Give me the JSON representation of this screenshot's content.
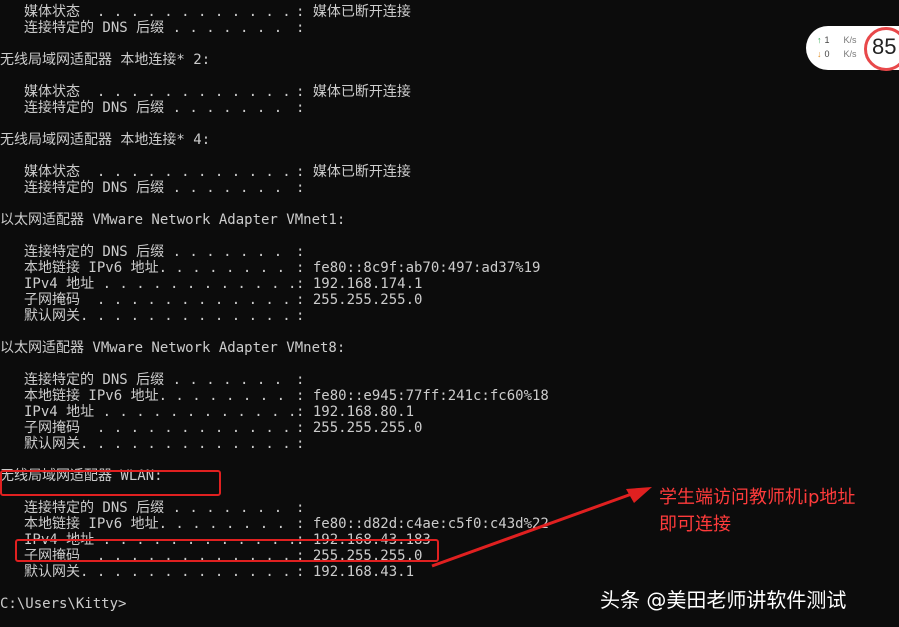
{
  "console": {
    "blocks": [
      {
        "type": "entry",
        "label": "媒体状态  . . . . . . . . . . . .",
        "value": "媒体已断开连接"
      },
      {
        "type": "entry",
        "label": "连接特定的 DNS 后缀 . . . . . . .",
        "value": ""
      },
      {
        "type": "blank"
      },
      {
        "type": "header",
        "text": "无线局域网适配器 本地连接* 2:"
      },
      {
        "type": "blank"
      },
      {
        "type": "entry",
        "label": "媒体状态  . . . . . . . . . . . .",
        "value": "媒体已断开连接"
      },
      {
        "type": "entry",
        "label": "连接特定的 DNS 后缀 . . . . . . .",
        "value": ""
      },
      {
        "type": "blank"
      },
      {
        "type": "header",
        "text": "无线局域网适配器 本地连接* 4:"
      },
      {
        "type": "blank"
      },
      {
        "type": "entry",
        "label": "媒体状态  . . . . . . . . . . . .",
        "value": "媒体已断开连接"
      },
      {
        "type": "entry",
        "label": "连接特定的 DNS 后缀 . . . . . . .",
        "value": ""
      },
      {
        "type": "blank"
      },
      {
        "type": "header",
        "text": "以太网适配器 VMware Network Adapter VMnet1:"
      },
      {
        "type": "blank"
      },
      {
        "type": "entry",
        "label": "连接特定的 DNS 后缀 . . . . . . .",
        "value": ""
      },
      {
        "type": "entry",
        "label": "本地链接 IPv6 地址. . . . . . . .",
        "value": "fe80::8c9f:ab70:497:ad37%19"
      },
      {
        "type": "entry",
        "label": "IPv4 地址 . . . . . . . . . . . .",
        "value": "192.168.174.1"
      },
      {
        "type": "entry",
        "label": "子网掩码  . . . . . . . . . . . .",
        "value": "255.255.255.0"
      },
      {
        "type": "entry",
        "label": "默认网关. . . . . . . . . . . . .",
        "value": ""
      },
      {
        "type": "blank"
      },
      {
        "type": "header",
        "text": "以太网适配器 VMware Network Adapter VMnet8:"
      },
      {
        "type": "blank"
      },
      {
        "type": "entry",
        "label": "连接特定的 DNS 后缀 . . . . . . .",
        "value": ""
      },
      {
        "type": "entry",
        "label": "本地链接 IPv6 地址. . . . . . . .",
        "value": "fe80::e945:77ff:241c:fc60%18"
      },
      {
        "type": "entry",
        "label": "IPv4 地址 . . . . . . . . . . . .",
        "value": "192.168.80.1"
      },
      {
        "type": "entry",
        "label": "子网掩码  . . . . . . . . . . . .",
        "value": "255.255.255.0"
      },
      {
        "type": "entry",
        "label": "默认网关. . . . . . . . . . . . .",
        "value": ""
      },
      {
        "type": "blank"
      },
      {
        "type": "header",
        "text": "无线局域网适配器 WLAN:"
      },
      {
        "type": "blank"
      },
      {
        "type": "entry",
        "label": "连接特定的 DNS 后缀 . . . . . . .",
        "value": ""
      },
      {
        "type": "entry",
        "label": "本地链接 IPv6 地址. . . . . . . .",
        "value": "fe80::d82d:c4ae:c5f0:c43d%22"
      },
      {
        "type": "entry",
        "label": "IPv4 地址 . . . . . . . . . . . .",
        "value": "192.168.43.183"
      },
      {
        "type": "entry",
        "label": "子网掩码  . . . . . . . . . . . .",
        "value": "255.255.255.0"
      },
      {
        "type": "entry",
        "label": "默认网关. . . . . . . . . . . . .",
        "value": "192.168.43.1"
      },
      {
        "type": "blank"
      },
      {
        "type": "prompt",
        "text": "C:\\Users\\Kitty>"
      }
    ],
    "separator": ": "
  },
  "speed_widget": {
    "up_value": "1",
    "down_value": "0",
    "unit": "K/s",
    "percent": "85"
  },
  "annotation": {
    "text": "学生端访问教师机ip地址\n即可连接",
    "color": "#ff3b3b"
  },
  "watermark": {
    "text": "头条 @美田老师讲软件测试"
  },
  "colors": {
    "background": "#0c0c0c",
    "console_text": "#cccccc",
    "highlight_box": "#e02020"
  }
}
